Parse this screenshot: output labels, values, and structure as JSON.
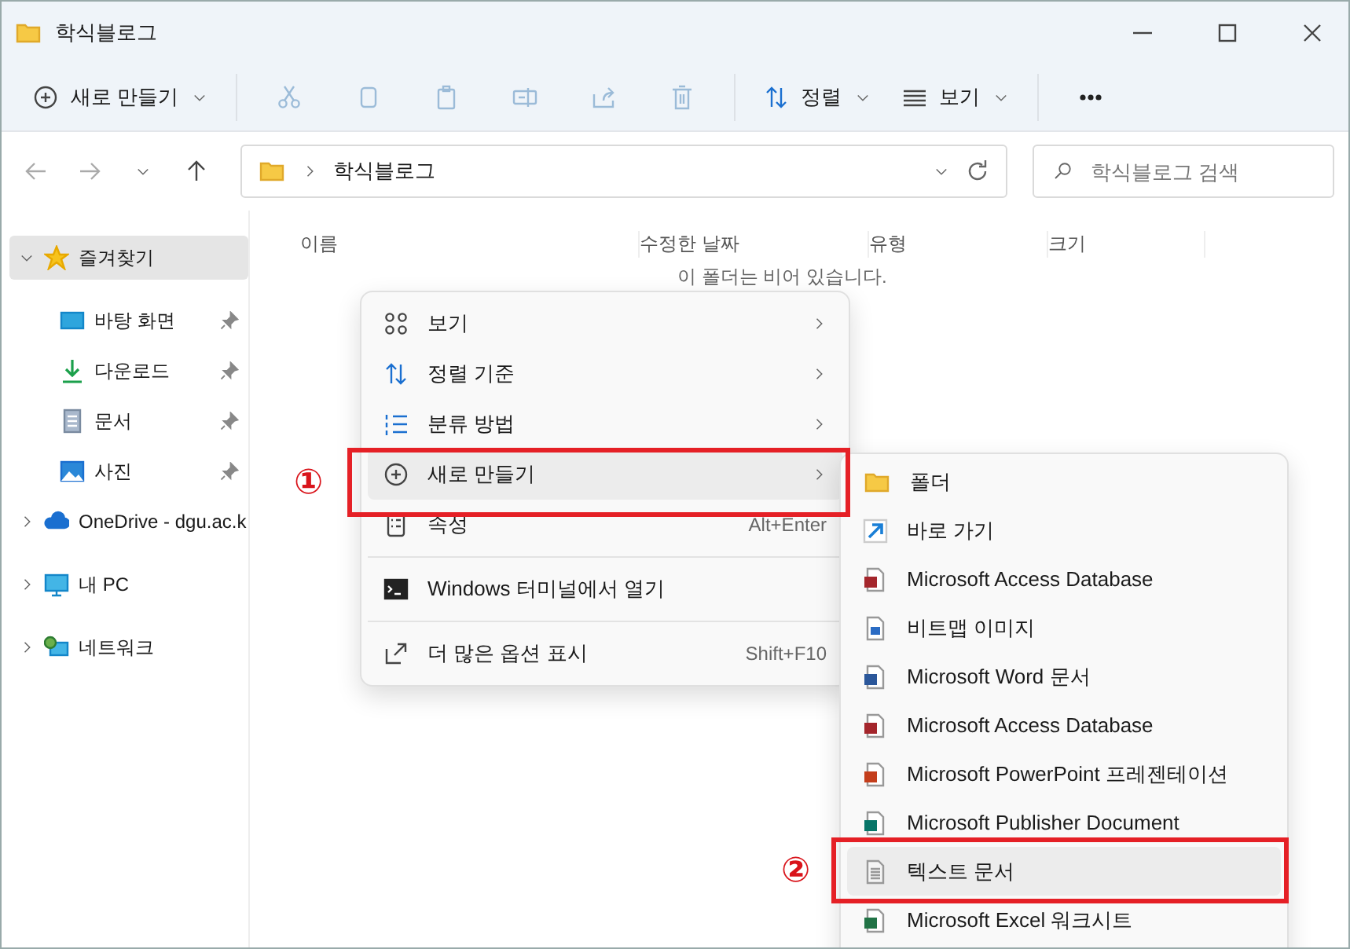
{
  "window": {
    "title": "학식블로그"
  },
  "toolbar": {
    "new": "새로 만들기",
    "sort": "정렬",
    "view": "보기"
  },
  "address": {
    "path": "학식블로그",
    "search_placeholder": "학식블로그 검색"
  },
  "sidebar": {
    "items": [
      {
        "label": "즐겨찾기",
        "expanded": true,
        "selected": true,
        "children": [
          {
            "label": "바탕 화면",
            "pinned": true
          },
          {
            "label": "다운로드",
            "pinned": true
          },
          {
            "label": "문서",
            "pinned": true
          },
          {
            "label": "사진",
            "pinned": true
          }
        ]
      },
      {
        "label": "OneDrive - dgu.ac.k",
        "expanded": false,
        "selected": false
      },
      {
        "label": "내 PC",
        "expanded": false,
        "selected": false
      },
      {
        "label": "네트워크",
        "expanded": false,
        "selected": false
      }
    ]
  },
  "columns": [
    "이름",
    "수정한 날짜",
    "유형",
    "크기"
  ],
  "empty_message": "이 폴더는 비어 있습니다.",
  "context_menu": [
    {
      "kind": "item",
      "label": "보기",
      "submenu": true,
      "selected": false
    },
    {
      "kind": "item",
      "label": "정렬 기준",
      "submenu": true,
      "selected": false
    },
    {
      "kind": "item",
      "label": "분류 방법",
      "submenu": true,
      "selected": false
    },
    {
      "kind": "item",
      "label": "새로 만들기",
      "submenu": true,
      "selected": true
    },
    {
      "kind": "item",
      "label": "속성",
      "shortcut": "Alt+Enter",
      "selected": false
    },
    {
      "kind": "separator"
    },
    {
      "kind": "item",
      "label": "Windows 터미널에서 열기",
      "selected": false
    },
    {
      "kind": "separator"
    },
    {
      "kind": "item",
      "label": "더 많은 옵션 표시",
      "shortcut": "Shift+F10",
      "selected": false
    }
  ],
  "new_submenu": [
    {
      "label": "폴더",
      "selected": false
    },
    {
      "label": "바로 가기",
      "selected": false
    },
    {
      "label": "Microsoft Access Database",
      "selected": false
    },
    {
      "label": "비트맵 이미지",
      "selected": false
    },
    {
      "label": "Microsoft Word 문서",
      "selected": false
    },
    {
      "label": "Microsoft Access Database",
      "selected": false
    },
    {
      "label": "Microsoft PowerPoint 프레젠테이션",
      "selected": false
    },
    {
      "label": "Microsoft Publisher Document",
      "selected": false
    },
    {
      "label": "텍스트 문서",
      "selected": true
    },
    {
      "label": "Microsoft Excel 워크시트",
      "selected": false
    }
  ],
  "annotations": [
    "①",
    "②"
  ]
}
